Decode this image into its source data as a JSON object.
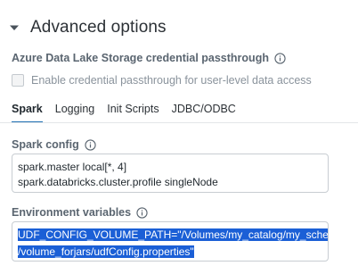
{
  "section": {
    "title": "Advanced options",
    "caret_icon": "caret-down-icon"
  },
  "passthrough": {
    "label": "Azure Data Lake Storage credential passthrough",
    "checkbox_label": "Enable credential passthrough for user-level data access",
    "checked": false
  },
  "tabs": [
    {
      "label": "Spark",
      "active": true
    },
    {
      "label": "Logging",
      "active": false
    },
    {
      "label": "Init Scripts",
      "active": false
    },
    {
      "label": "JDBC/ODBC",
      "active": false
    }
  ],
  "spark_config": {
    "label": "Spark config",
    "lines": [
      "spark.master local[*, 4]",
      "spark.databricks.cluster.profile singleNode"
    ]
  },
  "env_vars": {
    "label": "Environment variables",
    "lines": [
      "UDF_CONFIG_VOLUME_PATH=\"/Volumes/my_catalog/my_schema",
      "/volume_forjars/udfConfig.properties\""
    ],
    "selected": true
  },
  "colors": {
    "accent": "#2272b4",
    "selection": "#1b5fd6"
  }
}
